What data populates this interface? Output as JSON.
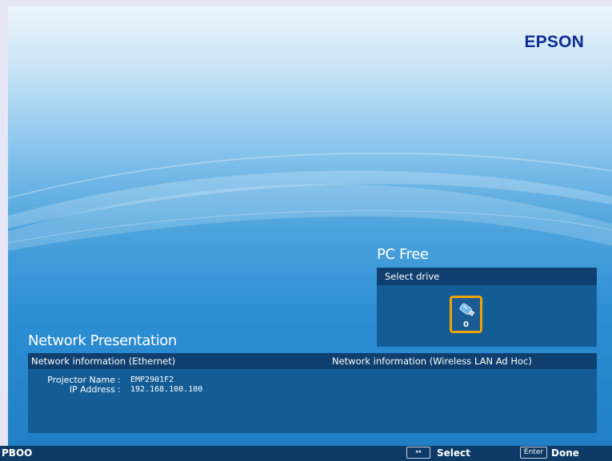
{
  "brand": {
    "logo_text": "EPSON"
  },
  "pc_free": {
    "title": "PC Free",
    "header": "Select drive",
    "drives": [
      {
        "number": "0",
        "icon": "usb-drive-icon",
        "selected": true
      }
    ]
  },
  "network_presentation": {
    "title": "Network Presentation",
    "ethernet_header": "Network information (Ethernet)",
    "wireless_header": "Network information (Wireless LAN Ad Hoc)",
    "fields": [
      {
        "label": "Projector Name",
        "separator": ":",
        "value": "EMP2901F2"
      },
      {
        "label": "IP Address",
        "separator": ":",
        "value": "192.168.100.100"
      }
    ]
  },
  "status_bar": {
    "left_label": "PBOO",
    "select_key": "↔",
    "select_label": "Select",
    "enter_key": "Enter",
    "done_label": "Done"
  },
  "colors": {
    "brand": "#0d2c96",
    "panel": "#145c95",
    "panel_header": "#0f3f6e",
    "selection": "#f0a400",
    "status_bar": "#0d3a66"
  }
}
